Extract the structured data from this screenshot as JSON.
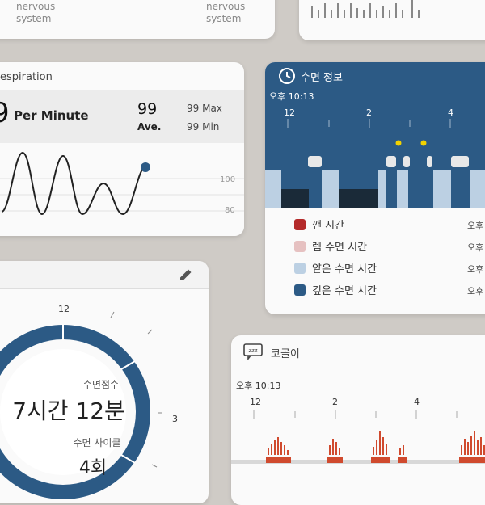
{
  "nervous_card": {
    "left_label": "nervous\nsystem",
    "right_label": "nervous\nsystem"
  },
  "respiration": {
    "title": "espiration",
    "current_value": "9",
    "unit": "Per Minute",
    "ave_value": "99",
    "ave_label": "Ave.",
    "max_text": "99 Max",
    "min_text": "99 Min",
    "axis_upper": "100",
    "axis_lower": "80"
  },
  "sleep_info": {
    "title": "수면 정보",
    "start_time": "오후 10:13",
    "hour_labels": [
      "12",
      "2",
      "4"
    ],
    "legend": [
      {
        "label": "깬 시간",
        "color": "#b42a2a",
        "right": "오후"
      },
      {
        "label": "렘 수면 시간",
        "color": "#e6c1c1",
        "right": "오후"
      },
      {
        "label": "얕은 수면 시간",
        "color": "#bcd0e3",
        "right": "오후"
      },
      {
        "label": "깊은 수면 시간",
        "color": "#2c5a85",
        "right": "오후"
      }
    ],
    "colors": {
      "header": "#2c5a85",
      "deep": "#1a2a38",
      "light": "#bcd0e3",
      "rem_marker": "#e8e8e8",
      "dot": "#f2d200"
    }
  },
  "sleep_score": {
    "dial_labels": [
      "12",
      "3"
    ],
    "score_label": "수면점수",
    "score_value": "7시간 12분",
    "cycle_label": "수면 사이클",
    "cycle_value": "4회",
    "ring_color": "#2c5a85"
  },
  "snoring": {
    "title": "코골이",
    "start_time": "오후 10:13",
    "hour_labels": [
      "12",
      "2",
      "4"
    ],
    "bar_color": "#d04a2e"
  }
}
